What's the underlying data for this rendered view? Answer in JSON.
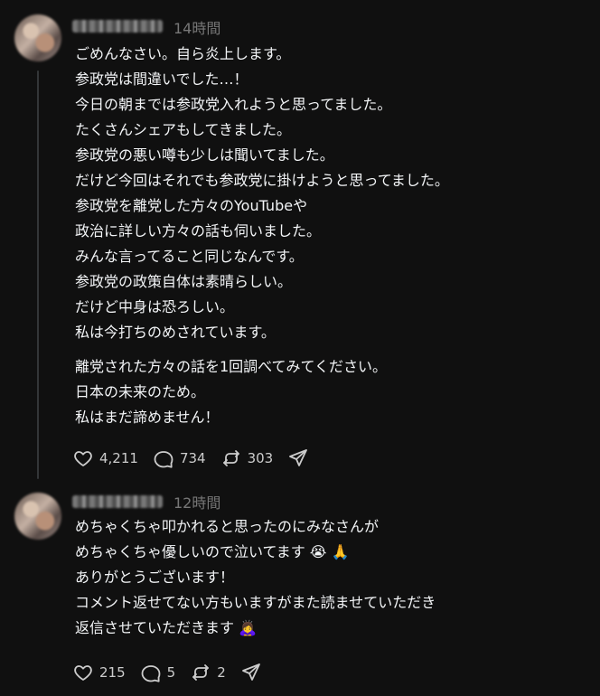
{
  "posts": [
    {
      "time": "14時間",
      "lines": [
        "ごめんなさい。自ら炎上します。",
        "参政党は間違いでした…！",
        "今日の朝までは参政党入れようと思ってました。",
        "たくさんシェアもしてきました。",
        "参政党の悪い噂も少しは聞いてました。",
        "だけど今回はそれでも参政党に掛けようと思ってました。",
        "参政党を離党した方々のYouTubeや",
        "政治に詳しい方々の話も伺いました。",
        "みんな言ってること同じなんです。",
        "参政党の政策自体は素晴らしい。",
        "だけど中身は恐ろしい。",
        "私は今打ちのめされています。"
      ],
      "lines2": [
        "離党された方々の話を1回調べてみてください。",
        "日本の未来のため。",
        "私はまだ諦めません！"
      ],
      "likes": "4,211",
      "replies": "734",
      "reposts": "303"
    },
    {
      "time": "12時間",
      "lines": [
        "めちゃくちゃ叩かれると思ったのにみなさんが",
        "めちゃくちゃ優しいので泣いてます 😭 🙏",
        "ありがとうございます！",
        "コメント返せてない方もいますがまた読ませていただき",
        "返信させていただきます 🙇‍♀️"
      ],
      "likes": "215",
      "replies": "5",
      "reposts": "2"
    }
  ],
  "icons": [
    "heart-icon",
    "comment-icon",
    "repost-icon",
    "share-icon"
  ]
}
